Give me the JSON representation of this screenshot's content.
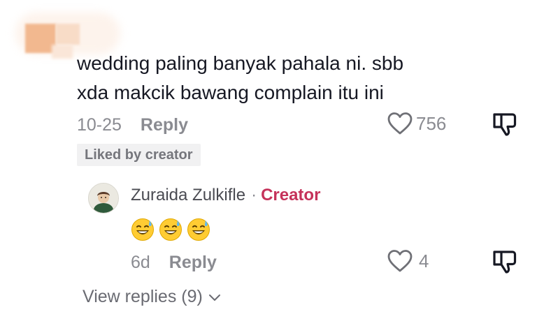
{
  "comment": {
    "text_line1": "wedding paling banyak pahala ni. sbb",
    "text_line2": "xda makcik bawang complain itu ini",
    "date": "10-25",
    "reply_label": "Reply",
    "like_count": "756",
    "liked_by_creator": "Liked by creator"
  },
  "reply": {
    "author": "Zuraida Zulkifle",
    "separator": "·",
    "creator_badge": "Creator",
    "emoji": [
      "😅",
      "😅",
      "😅"
    ],
    "date": "6d",
    "reply_label": "Reply",
    "like_count": "4"
  },
  "view_replies": {
    "label": "View replies (9)"
  },
  "icons": {
    "like": "heart-outline-icon",
    "dislike": "thumbs-down-icon",
    "expand": "chevron-down-icon"
  },
  "colors": {
    "text": "#161823",
    "muted": "#8a8b91",
    "creator_accent": "#c5325a",
    "badge_bg": "#f1f1f2"
  }
}
